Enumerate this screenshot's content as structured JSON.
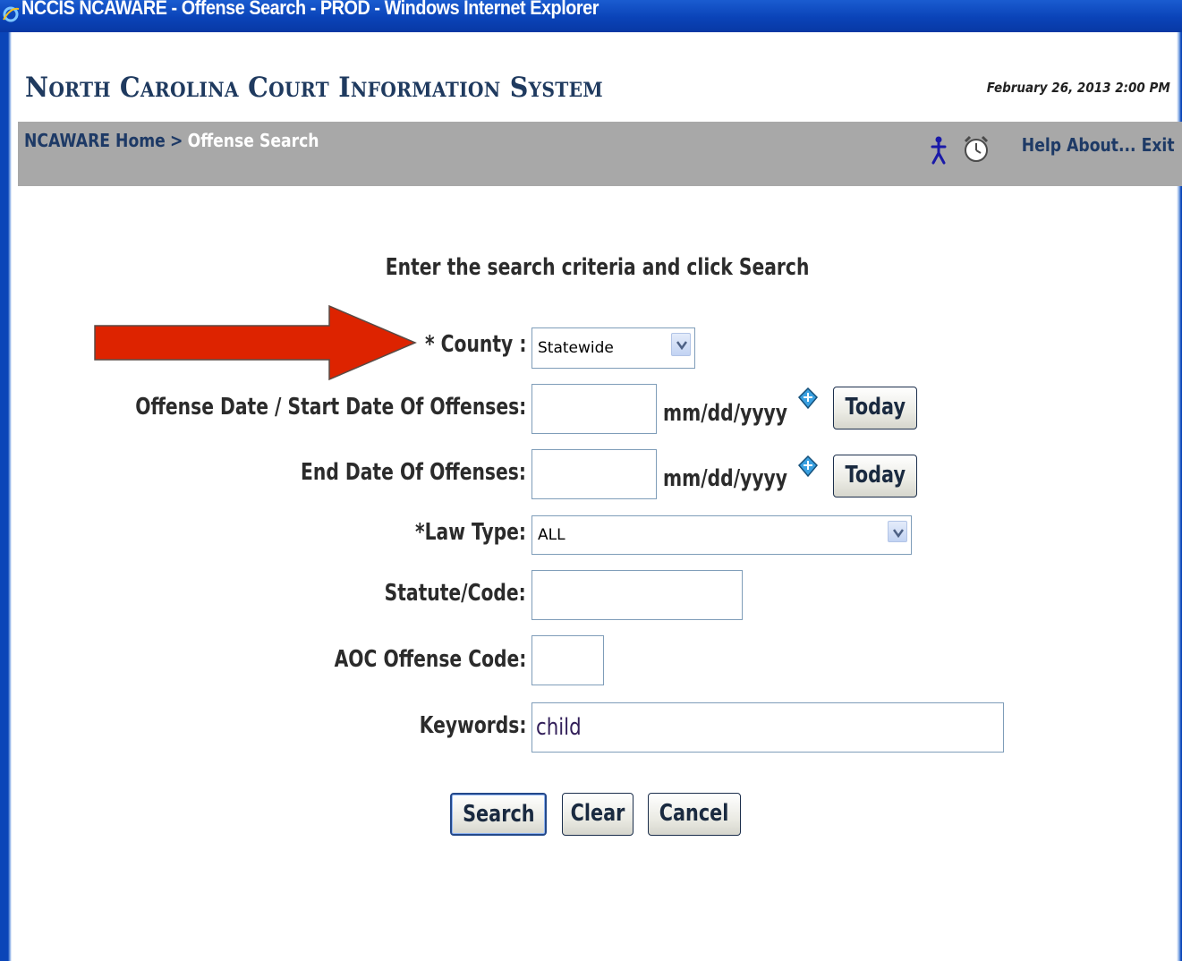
{
  "window": {
    "title": "NCCIS NCAWARE - Offense Search - PROD - Windows Internet Explorer"
  },
  "header": {
    "system_title": "North Carolina Court Information System",
    "datetime": "February 26, 2013 2:00 PM"
  },
  "navbar": {
    "breadcrumb_home": "NCAWARE Home",
    "breadcrumb_separator": ">",
    "breadcrumb_current": "Offense Search",
    "help": "Help",
    "about": "About...",
    "exit": "Exit"
  },
  "form": {
    "instructions": "Enter the search criteria and click Search",
    "county_label": "* County :",
    "county_value": "Statewide",
    "offense_date_label": "Offense Date / Start Date Of Offenses:",
    "offense_date_value": "",
    "end_date_label": "End Date Of Offenses:",
    "end_date_value": "",
    "date_format": "mm/dd/yyyy",
    "today_label": "Today",
    "law_type_label": "*Law Type:",
    "law_type_value": "ALL",
    "statute_label": "Statute/Code:",
    "statute_value": "",
    "aoc_label": "AOC Offense Code:",
    "aoc_value": "",
    "keywords_label": "Keywords:",
    "keywords_value": "child"
  },
  "actions": {
    "search": "Search",
    "clear": "Clear",
    "cancel": "Cancel"
  },
  "icons": {
    "browser": "ie-icon",
    "person": "person-icon",
    "clock": "alarm-clock-icon",
    "calendar": "calendar-icon",
    "dropdown": "chevron-down-icon",
    "annotation": "red-arrow-icon"
  },
  "colors": {
    "titlebar": "#0a43b8",
    "navbar": "#a8a8a8",
    "breadcrumb_link": "#1e3a66",
    "annotation_arrow": "#dd2300"
  }
}
